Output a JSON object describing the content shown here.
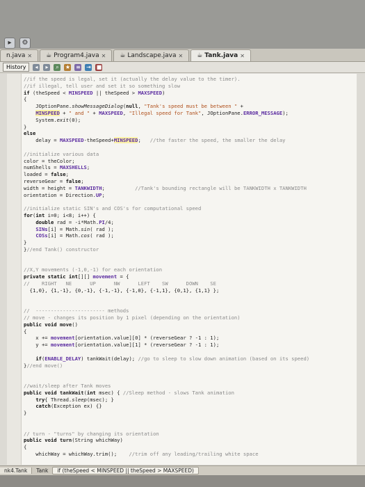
{
  "tabs": [
    {
      "label": "n.java",
      "active": false
    },
    {
      "label": "Program4.java",
      "active": false
    },
    {
      "label": "Landscape.java",
      "active": false
    },
    {
      "label": "Tank.java",
      "active": true
    }
  ],
  "toolbar": {
    "history_label": "History"
  },
  "code": [
    {
      "html": "<span class='cm'>//if the speed is legal, set it (actually the delay value to the timer).</span>"
    },
    {
      "html": "<span class='cm'>//if illegal, tell user and set it so something slow</span>"
    },
    {
      "html": "<span class='kw'>if</span> (theSpeed &lt; <span class='cst'>MINSPEED</span> || theSpeed &gt; <span class='cst'>MAXSPEED</span>)"
    },
    {
      "html": "{"
    },
    {
      "html": "    JOptionPane.<i>showMessageDialog</i>(<span class='kw'>null</span>, <span class='str'>\"Tank's speed must be between \"</span> +"
    },
    {
      "html": "    <span class='cst hl'>MINSPEED</span> + <span class='str'>\" and \"</span> + <span class='cst'>MAXSPEED</span>, <span class='str'>\"Illegal speed for Tank\"</span>, JOptionPane.<span class='cst'>ERROR_MESSAGE</span>);"
    },
    {
      "html": "    System.<i>exit</i>(0);"
    },
    {
      "html": "}"
    },
    {
      "html": "<span class='kw'>else</span>"
    },
    {
      "html": "    delay = <span class='cst'>MAXSPEED</span>-theSpeed+<span class='cst hl'>MINSPEED</span>;   <span class='cm'>//the faster the speed, the smaller the delay</span>"
    },
    {
      "html": ""
    },
    {
      "html": "<span class='cm'>//initialize various data</span>"
    },
    {
      "html": "color = theColor;"
    },
    {
      "html": "numShells = <span class='cst'>MAXSHELLS</span>;"
    },
    {
      "html": "loaded = <span class='kw'>false</span>;"
    },
    {
      "html": "reverseGear = <span class='kw'>false</span>;"
    },
    {
      "html": "width = height = <span class='cst'>TANKWIDTH</span>;          <span class='cm'>//Tank's bounding rectangle will be TANKWIDTH x TANKWIDTH</span>"
    },
    {
      "html": "orientation = Direction.<span class='cst'>UP</span>;"
    },
    {
      "html": ""
    },
    {
      "html": "<span class='cm'>//initialize static SIN's and COS's for computational speed</span>"
    },
    {
      "html": "<span class='kw'>for</span>(<span class='kw'>int</span> i=0; i&lt;8; i++) {"
    },
    {
      "html": "    <span class='kw'>double</span> rad = -i*Math.<span class='cst'>PI</span>/4;"
    },
    {
      "html": "    <span class='cst'>SINs</span>[i] = Math.<i>sin</i>( rad );"
    },
    {
      "html": "    <span class='cst'>COSs</span>[i] = Math.<i>cos</i>( rad );"
    },
    {
      "html": "}"
    },
    {
      "html": "}<span class='cm'>//end Tank() constructor</span>"
    },
    {
      "html": ""
    },
    {
      "html": ""
    },
    {
      "html": "<span class='cm'>//X,Y movements (-1,0,-1) for each orientation</span>"
    },
    {
      "html": "<span class='kw'>private static int</span>[][] <span class='cst'>movement</span> = {"
    },
    {
      "html": "<span class='cm'>//    RIGHT   NE      UP      NW      LEFT    SW      DOWN    SE</span>"
    },
    {
      "html": "  {1,0}, {1,-1}, {0,-1}, {-1,-1}, {-1,0}, {-1,1}, {0,1}, {1,1} };"
    },
    {
      "html": ""
    },
    {
      "html": ""
    },
    {
      "html": "<span class='cm'>//  ----------------------- methods</span>"
    },
    {
      "html": "<span class='cm'>// move - changes its position by 1 pixel (depending on the orientation)</span>"
    },
    {
      "html": "<span class='kw'>public void</span> <b>move</b>()"
    },
    {
      "html": "{"
    },
    {
      "html": "    x += <span class='cst'>movement</span>[orientation.value][0] * (reverseGear ? -1 : 1);"
    },
    {
      "html": "    y += <span class='cst'>movement</span>[orientation.value][1] * (reverseGear ? -1 : 1);"
    },
    {
      "html": ""
    },
    {
      "html": "    <span class='kw'>if</span>(<span class='cst'>ENABLE_DELAY</span>) tankWait(delay); <span class='cm'>//go to sleep to slow down animation (based on its speed)</span>"
    },
    {
      "html": "}<span class='cm'>//end move()</span>"
    },
    {
      "html": ""
    },
    {
      "html": ""
    },
    {
      "html": "<span class='cm'>//wait/sleep after Tank moves</span>"
    },
    {
      "html": "<span class='kw'>public void</span> <b>tankWait</b>(<span class='kw'>int</span> msec) { <span class='cm'>//Sleep method - slows Tank animation</span>"
    },
    {
      "html": "    <span class='kw'>try</span>{ Thread.<i>sleep</i>(msec); }"
    },
    {
      "html": "    <span class='kw'>catch</span>(Exception ex) {}"
    },
    {
      "html": "}"
    },
    {
      "html": ""
    },
    {
      "html": ""
    },
    {
      "html": "<span class='cm'>// turn - \"turns\" by changing its orientation</span>"
    },
    {
      "html": "<span class='kw'>public void</span> <b>turn</b>(String whichWay)"
    },
    {
      "html": "{"
    },
    {
      "html": "    whichWay = whichWay.trim();    <span class='cm'>//trim off any leading/trailing white space</span>"
    }
  ],
  "status": {
    "left": "nk4.Tank",
    "crumb": "Tank",
    "condition": "if (theSpeed < MINSPEED || theSpeed > MAXSPEED)"
  }
}
